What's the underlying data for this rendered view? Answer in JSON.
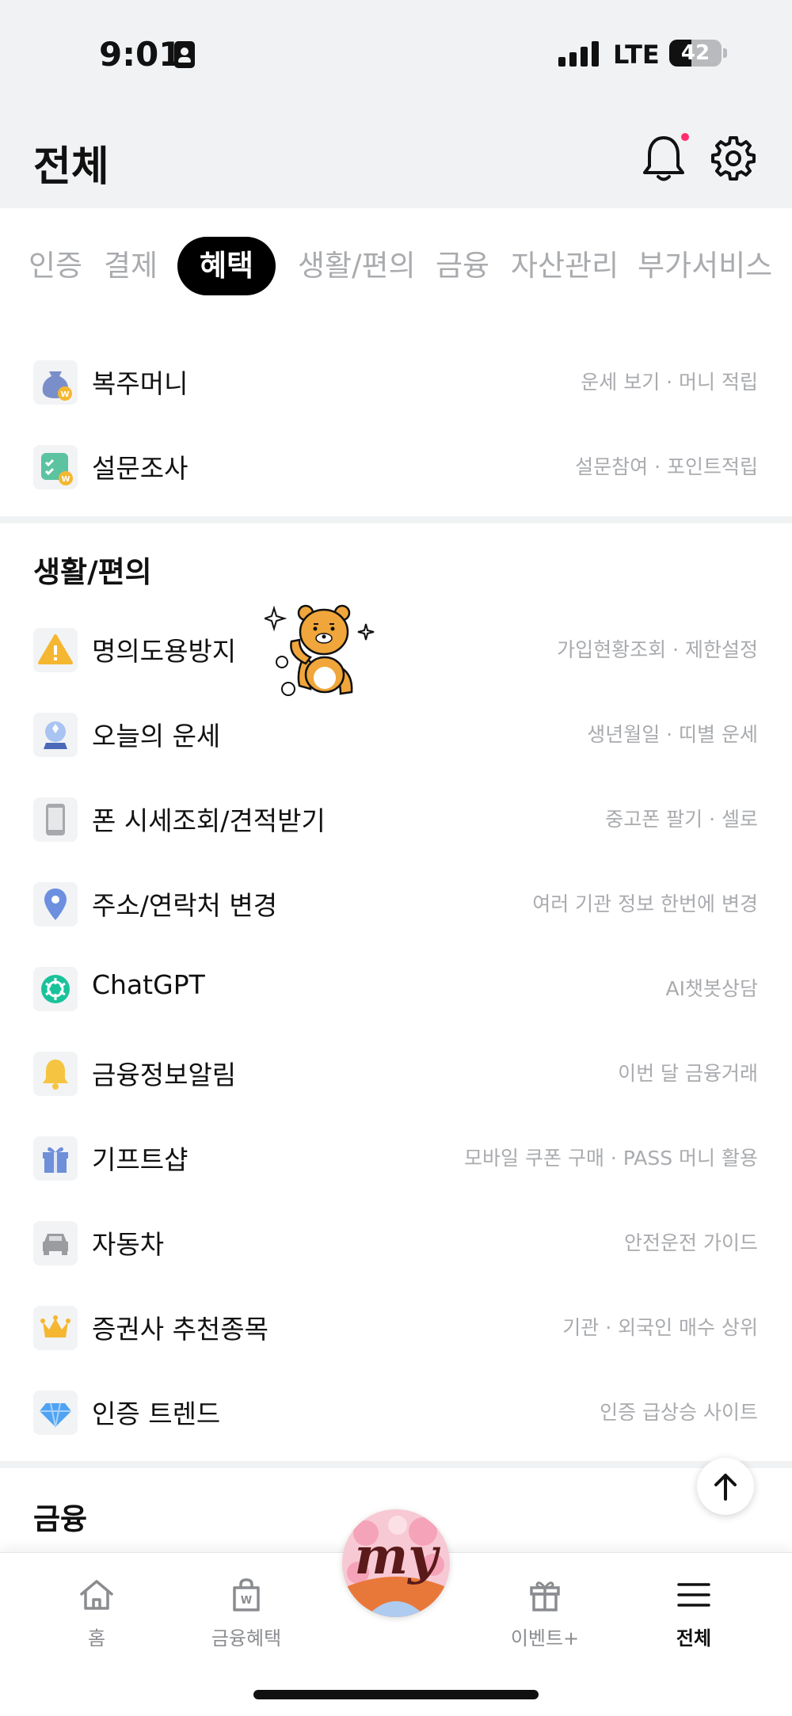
{
  "status_bar": {
    "time": "9:01",
    "network": "LTE",
    "battery": "42",
    "battery_level_percent": 42
  },
  "header": {
    "title": "전체"
  },
  "tabs": [
    {
      "label": "인증",
      "active": false
    },
    {
      "label": "결제",
      "active": false
    },
    {
      "label": "혜택",
      "active": true
    },
    {
      "label": "생활/편의",
      "active": false
    },
    {
      "label": "금융",
      "active": false
    },
    {
      "label": "자산관리",
      "active": false
    },
    {
      "label": "부가서비스",
      "active": false
    }
  ],
  "benefits": {
    "items": [
      {
        "label": "복주머니",
        "desc": "운세 보기 · 머니 적립",
        "icon": "lucky-bag-icon"
      },
      {
        "label": "설문조사",
        "desc": "설문참여 · 포인트적립",
        "icon": "survey-icon"
      }
    ]
  },
  "life": {
    "title": "생활/편의",
    "items": [
      {
        "label": "명의도용방지",
        "desc": "가입현황조회 · 제한설정",
        "icon": "warning-icon"
      },
      {
        "label": "오늘의 운세",
        "desc": "생년월일 · 띠별 운세",
        "icon": "crystal-ball-icon"
      },
      {
        "label": "폰 시세조회/견적받기",
        "desc": "중고폰 팔기 · 셀로",
        "icon": "phone-icon"
      },
      {
        "label": "주소/연락처 변경",
        "desc": "여러 기관 정보 한번에 변경",
        "icon": "location-pin-icon"
      },
      {
        "label": "ChatGPT",
        "desc": "AI챗봇상담",
        "icon": "chatgpt-icon"
      },
      {
        "label": "금융정보알림",
        "desc": "이번 달 금융거래",
        "icon": "bell-icon"
      },
      {
        "label": "기프트샵",
        "desc": "모바일 쿠폰 구매 · PASS 머니 활용",
        "icon": "gift-icon"
      },
      {
        "label": "자동차",
        "desc": "안전운전 가이드",
        "icon": "car-icon"
      },
      {
        "label": "증권사 추천종목",
        "desc": "기관 · 외국인 매수 상위",
        "icon": "crown-icon"
      },
      {
        "label": "인증 트렌드",
        "desc": "인증 급상승 사이트",
        "icon": "diamond-icon"
      }
    ]
  },
  "finance": {
    "title": "금융"
  },
  "bottom_nav": {
    "home": "홈",
    "finance_benefit": "금융혜택",
    "my": "my",
    "event": "이벤트+",
    "all": "전체"
  },
  "colors": {
    "accent_dot": "#ff2d6f",
    "active_tab_bg": "#000000",
    "muted_text": "#a9abae"
  }
}
